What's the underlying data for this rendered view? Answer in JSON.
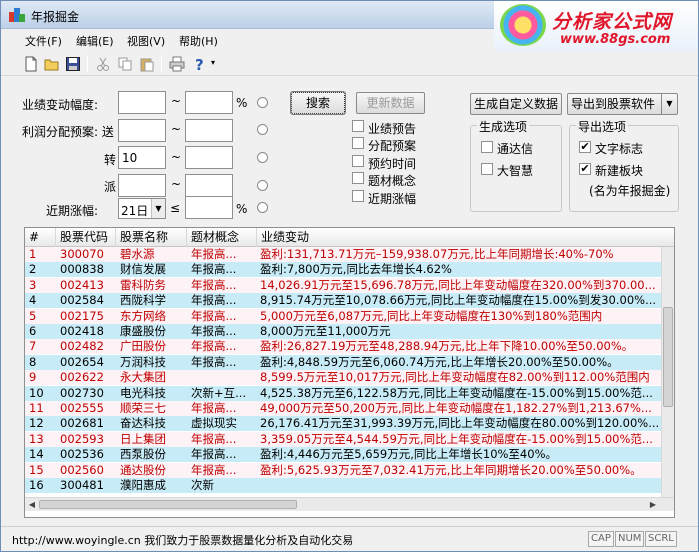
{
  "window": {
    "title": "年报掘金"
  },
  "logo": {
    "title": "分析家公式网",
    "url": "www.88gs.com"
  },
  "menu": [
    {
      "label": "文件(F)"
    },
    {
      "label": "编辑(E)"
    },
    {
      "label": "视图(V)"
    },
    {
      "label": "帮助(H)"
    }
  ],
  "form": {
    "perf_change_label": "业绩变动幅度:",
    "profit_label": "利润分配预案: 送",
    "zhuan_label": "转",
    "zhuan_value": "10",
    "pai_label": "派",
    "recent_label": "近期涨幅:",
    "recent_select": "21日",
    "tilde": "~",
    "percent": "%",
    "lte": "≤",
    "search_button": "搜索",
    "update_button": "更新数据",
    "options": [
      "业绩预告",
      "分配预案",
      "预约时间",
      "题材概念",
      "近期涨幅"
    ],
    "custom_data_button": "生成自定义数据",
    "export_button": "导出到股票软件",
    "gen_options_title": "生成选项",
    "gen_options": [
      "通达信",
      "大智慧"
    ],
    "export_options_title": "导出选项",
    "export_options": [
      "文字标志",
      "新建板块"
    ],
    "export_note": "(名为年报掘金)"
  },
  "table": {
    "headers": [
      "#",
      "股票代码",
      "股票名称",
      "题材概念",
      "业绩变动"
    ],
    "rows": [
      {
        "num": "1",
        "code": "300070",
        "name": "碧水源",
        "topic": "年报高...",
        "perf": "盈利:131,713.71万元–159,938.07万元,比上年同期增长:40%-70%",
        "color": "red"
      },
      {
        "num": "2",
        "code": "000838",
        "name": "财信发展",
        "topic": "年报高...",
        "perf": "盈利:7,800万元,同比去年增长4.62%",
        "color": "blk"
      },
      {
        "num": "3",
        "code": "002413",
        "name": "雷科防务",
        "topic": "年报高...",
        "perf": "14,026.91万元至15,696.78万元,同比上年变动幅度在320.00%到370.00...",
        "color": "red"
      },
      {
        "num": "4",
        "code": "002584",
        "name": "西陇科学",
        "topic": "年报高...",
        "perf": "8,915.74万元至10,078.66万元,同比上年变动幅度在15.00%到发30.00%...",
        "color": "blk"
      },
      {
        "num": "5",
        "code": "002175",
        "name": "东方网络",
        "topic": "年报高...",
        "perf": "5,000万元至6,087万元,同比上年变动幅度在130%到180%范围内",
        "color": "red"
      },
      {
        "num": "6",
        "code": "002418",
        "name": "康盛股份",
        "topic": "年报高...",
        "perf": "8,000万元至11,000万元",
        "color": "blk"
      },
      {
        "num": "7",
        "code": "002482",
        "name": "广田股份",
        "topic": "年报高...",
        "perf": "盈利:26,827.19万元至48,288.94万元,比上年下降10.00%至50.00%。",
        "color": "red"
      },
      {
        "num": "8",
        "code": "002654",
        "name": "万润科技",
        "topic": "年报高...",
        "perf": "盈利:4,848.59万元至6,060.74万元,比上年增长20.00%至50.00%。",
        "color": "blk"
      },
      {
        "num": "9",
        "code": "002622",
        "name": "永大集团",
        "topic": "",
        "perf": "8,599.5万元至10,017万元,同比上年变动幅度在82.00%到112.00%范围内",
        "color": "red"
      },
      {
        "num": "10",
        "code": "002730",
        "name": "电光科技",
        "topic": "次新+互...",
        "perf": "4,525.38万元至6,122.58万元,同比上年变动幅度在-15.00%到15.00%范...",
        "color": "blk"
      },
      {
        "num": "11",
        "code": "002555",
        "name": "顺荣三七",
        "topic": "年报高...",
        "perf": "49,000万元至50,200万元,同比上年变动幅度在1,182.27%到1,213.67%...",
        "color": "red"
      },
      {
        "num": "12",
        "code": "002681",
        "name": "奋达科技",
        "topic": "虚拟现实",
        "perf": "26,176.41万元至31,993.39万元,同比上年变动幅度在80.00%到120.00%...",
        "color": "blk"
      },
      {
        "num": "13",
        "code": "002593",
        "name": "日上集团",
        "topic": "年报高...",
        "perf": "3,359.05万元至4,544.59万元,同比上年变动幅度在-15.00%到15.00%范...",
        "color": "red"
      },
      {
        "num": "14",
        "code": "002536",
        "name": "西泵股份",
        "topic": "年报高...",
        "perf": "盈利:4,446万元至5,659万元,同比上年增长10%至40%。",
        "color": "blk"
      },
      {
        "num": "15",
        "code": "002560",
        "name": "通达股份",
        "topic": "年报高...",
        "perf": "盈利:5,625.93万元至7,032.41万元,比上年同期增长20.00%至50.00%。",
        "color": "red"
      },
      {
        "num": "16",
        "code": "300481",
        "name": "濮阳惠成",
        "topic": "次新",
        "perf": "",
        "color": "blk"
      }
    ]
  },
  "status": {
    "text": "http://www.woyingle.cn 我们致力于股票数据量化分析及自动化交易",
    "indicators": [
      "CAP",
      "NUM",
      "SCRL"
    ]
  },
  "colors": {
    "red_text": "#c00000",
    "row_even": "#c8ecf7",
    "row_odd": "#fdf3f7"
  }
}
